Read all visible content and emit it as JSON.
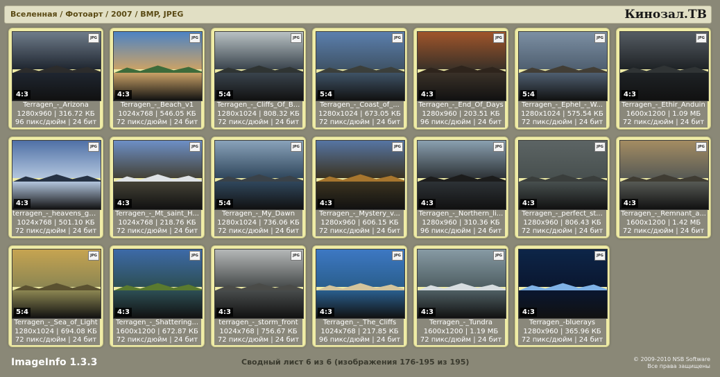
{
  "header": {
    "breadcrumb": "Вселенная / Фотоарт / 2007 / BMP, JPEG",
    "brand": "Кинозал.ТВ"
  },
  "badge_label": "JPG",
  "tiles": [
    {
      "name": "Terragen_-_Arizona",
      "dims": "1280x960 | 316.72 КБ",
      "res": "96 пикс/дюйм | 24 бит",
      "ratio": "4:3",
      "colors": [
        "#6f7c8a",
        "#2c2c2c",
        "#1f2630"
      ]
    },
    {
      "name": "Terragen_-_Beach_v1",
      "dims": "1024x768 | 546.05 КБ",
      "res": "72 пикс/дюйм | 24 бит",
      "ratio": "4:3",
      "colors": [
        "#4d83c4",
        "#3d6b3a",
        "#caa267"
      ]
    },
    {
      "name": "Terragen_-_Cliffs_Of_B...",
      "dims": "1280x1024 | 808.32 КБ",
      "res": "72 пикс/дюйм | 24 бит",
      "ratio": "5:4",
      "colors": [
        "#b9c2c4",
        "#2f3433",
        "#3a444d"
      ]
    },
    {
      "name": "Terragen_-_Coast_of_...",
      "dims": "1280x1024 | 673.05 КБ",
      "res": "72 пикс/дюйм | 24 бит",
      "ratio": "5:4",
      "colors": [
        "#5b7fae",
        "#3b3f3b",
        "#3f5366"
      ]
    },
    {
      "name": "Terragen_-_End_Of_Days",
      "dims": "1280x960 | 203.51 КБ",
      "res": "96 пикс/дюйм | 24 бит",
      "ratio": "4:3",
      "colors": [
        "#a0552a",
        "#2e241c",
        "#3a3128"
      ]
    },
    {
      "name": "Terragen_-_Ephel_-_W...",
      "dims": "1280x1024 | 575.54 КБ",
      "res": "72 пикс/дюйм | 24 бит",
      "ratio": "5:4",
      "colors": [
        "#7c8fa3",
        "#423e36",
        "#4f5f70"
      ]
    },
    {
      "name": "Terragen_-_Ethir_Anduin",
      "dims": "1600x1200 | 1.09 МБ",
      "res": "72 пикс/дюйм | 24 бит",
      "ratio": "4:3",
      "colors": [
        "#555c63",
        "#303435",
        "#1e2225"
      ]
    },
    {
      "name": "terragen_-_heavens_gate",
      "dims": "1024x768 | 501.10 КБ",
      "res": "72 пикс/дюйм | 24 бит",
      "ratio": "4:3",
      "colors": [
        "#4f70a6",
        "#263244",
        "#b3c6de"
      ]
    },
    {
      "name": "Terragen_-_Mt_saint_H...",
      "dims": "1024x768 | 218.76 КБ",
      "res": "72 пикс/дюйм | 24 бит",
      "ratio": "4:3",
      "colors": [
        "#6d8fc6",
        "#dfe3e6",
        "#444236"
      ]
    },
    {
      "name": "Terragen_-_My_Dawn",
      "dims": "1280x1024 | 736.06 КБ",
      "res": "72 пикс/дюйм | 24 бит",
      "ratio": "5:4",
      "colors": [
        "#89a2ba",
        "#3a4249",
        "#30475c"
      ]
    },
    {
      "name": "Terragen_-_Mystery_v...",
      "dims": "1280x960 | 606.15 КБ",
      "res": "72 пикс/дюйм | 24 бит",
      "ratio": "4:3",
      "colors": [
        "#5675a3",
        "#a7762e",
        "#3b3320"
      ]
    },
    {
      "name": "Terragen_-_Northern_li...",
      "dims": "1280x960 | 310.36 КБ",
      "res": "96 пикс/дюйм | 24 бит",
      "ratio": "4:3",
      "colors": [
        "#8aa0b0",
        "#1c1c1c",
        "#2d3236"
      ]
    },
    {
      "name": "Terragen_-_perfect_st...",
      "dims": "1280x960 | 806.43 КБ",
      "res": "72 пикс/дюйм | 24 бит",
      "ratio": "4:3",
      "colors": [
        "#5c6464",
        "#3a3e3c",
        "#48504f"
      ]
    },
    {
      "name": "Terragen_-_Remnant_a...",
      "dims": "1600x1200 | 1.42 МБ",
      "res": "72 пикс/дюйм | 24 бит",
      "ratio": "4:3",
      "colors": [
        "#a48c62",
        "#3f3c33",
        "#575a55"
      ]
    },
    {
      "name": "Terragen_-_Sea_of_Light",
      "dims": "1280x1024 | 694.08 КБ",
      "res": "72 пикс/дюйм | 24 бит",
      "ratio": "5:4",
      "colors": [
        "#c6a451",
        "#5a5130",
        "#8c8652"
      ]
    },
    {
      "name": "Terragen_-_Shattering...",
      "dims": "1600x1200 | 672.87 КБ",
      "res": "72 пикс/дюйм | 24 бит",
      "ratio": "4:3",
      "colors": [
        "#3d6aa8",
        "#5a7a2f",
        "#2d4f55"
      ]
    },
    {
      "name": "terragen_-_storm_front",
      "dims": "1024x768 | 756.67 КБ",
      "res": "72 пикс/дюйм | 24 бит",
      "ratio": "4:3",
      "colors": [
        "#b5b8b8",
        "#4a4b48",
        "#484c4c"
      ]
    },
    {
      "name": "Terragen_-_The_Cliffs",
      "dims": "1024x768 | 217.85 КБ",
      "res": "96 пикс/дюйм | 24 бит",
      "ratio": "4:3",
      "colors": [
        "#3d78c3",
        "#d3c49c",
        "#2a5f8e"
      ]
    },
    {
      "name": "Terragen_-_Tundra",
      "dims": "1600x1200 | 1.19 МБ",
      "res": "72 пикс/дюйм | 24 бит",
      "ratio": "4:3",
      "colors": [
        "#879aa4",
        "#d7dde0",
        "#4f5f63"
      ]
    },
    {
      "name": "Terragen_-bluerays",
      "dims": "1280x960 | 365.96 КБ",
      "res": "72 пикс/дюйм | 24 бит",
      "ratio": "4:3",
      "colors": [
        "#0d2548",
        "#7fb2e6",
        "#0a1730"
      ]
    }
  ],
  "footer": {
    "app_name": "ImageInfo 1.3.3",
    "summary": "Сводный лист 6 из 6 (изображения 176-195 из 195)",
    "copyright": "© 2009-2010 NSB Software",
    "rights": "Все права защищены"
  }
}
